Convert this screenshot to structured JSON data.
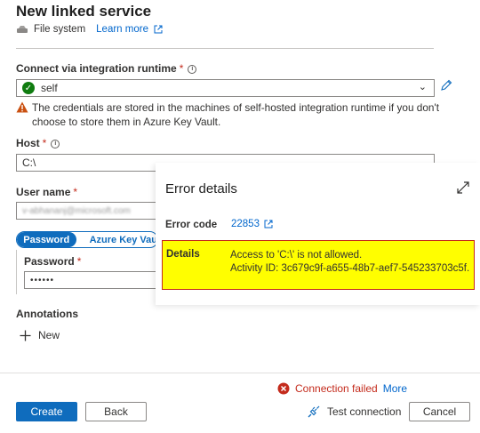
{
  "header": {
    "title": "New linked service",
    "service_type": "File system",
    "learn_more": "Learn more"
  },
  "runtime": {
    "label": "Connect via integration runtime",
    "required_mark": "*",
    "selected": "self",
    "status": "ok",
    "warning": "The credentials are stored in the machines of self-hosted integration runtime if you don't choose to store them in Azure Key Vault."
  },
  "host": {
    "label": "Host",
    "required_mark": "*",
    "value": "C:\\"
  },
  "user_name": {
    "label": "User name",
    "required_mark": "*",
    "value": "v-abhananj@microsoft.com"
  },
  "auth_tabs": {
    "password": "Password",
    "akv": "Azure Key Vau"
  },
  "password": {
    "label": "Password",
    "required_mark": "*",
    "value": "••••••"
  },
  "annotations": {
    "label": "Annotations",
    "new": "New"
  },
  "status": {
    "text": "Connection failed",
    "more": "More",
    "color": "#c42b1c"
  },
  "footer": {
    "create": "Create",
    "back": "Back",
    "test": "Test connection",
    "cancel": "Cancel"
  },
  "error_panel": {
    "title": "Error details",
    "code_label": "Error code",
    "code_value": "22853",
    "details_label": "Details",
    "details_line1": "Access to 'C:\\' is not allowed.",
    "details_line2": "Activity ID: 3c679c9f-a655-48b7-aef7-545233703c5f.",
    "highlight_color": "#fffe00",
    "border_color": "#c42b1c"
  },
  "colors": {
    "accent": "#0f6cbd",
    "ok": "#107c10",
    "warning": "#ca5010"
  }
}
